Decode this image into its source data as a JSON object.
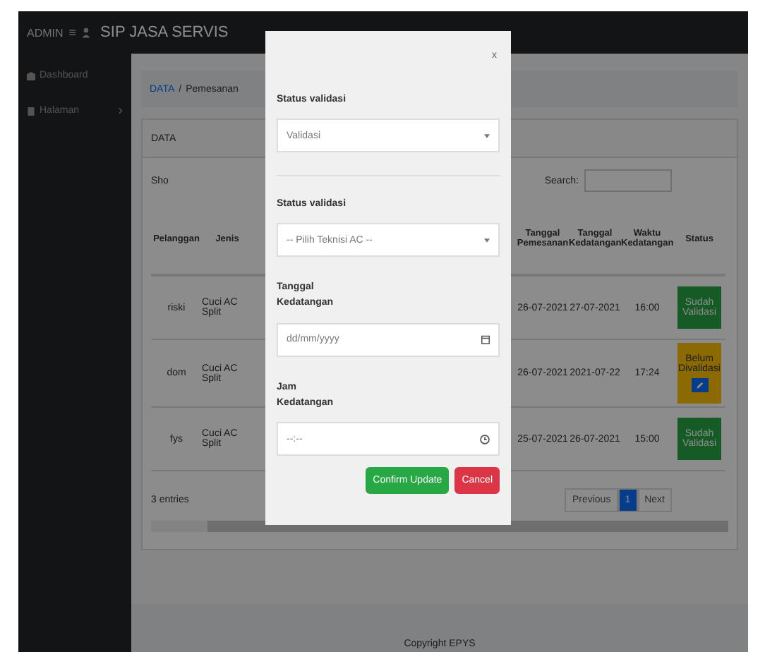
{
  "navbar": {
    "user": "ADMIN",
    "menu_glyph": "≡",
    "brand": "SIP JASA SERVIS"
  },
  "sidebar": {
    "items": [
      {
        "label": "Dashboard",
        "selected": false,
        "expandable": false
      },
      {
        "label": "Halaman",
        "selected": false,
        "expandable": true
      }
    ]
  },
  "breadcrumb": [
    "DATA",
    "/",
    "Pemesanan"
  ],
  "card": {
    "title": "DATA",
    "show_label": "Sho",
    "search_label": "Search:"
  },
  "table": {
    "columns": [
      "Pelanggan",
      "Jenis",
      "Tanggal Pemesanan",
      "Tanggal Kedatangan",
      "Waktu Kedatangan",
      "Status"
    ],
    "rows": [
      {
        "cells": [
          "riski",
          "Cuci AC Split",
          "26-07-2021",
          "27-07-2021",
          "16:00"
        ],
        "status": "Sudah Validasi",
        "validated": true
      },
      {
        "cells": [
          "dom",
          "Cuci AC Split",
          "26-07-2021",
          "2021-07-22",
          "17:24"
        ],
        "status": "Belum Divalidasi",
        "validated": false
      },
      {
        "cells": [
          "fys",
          "Cuci AC Split",
          "25-07-2021",
          "26-07-2021",
          "15:00"
        ],
        "status": "Sudah Validasi",
        "validated": true
      }
    ]
  },
  "info": "3 entries",
  "pagination": [
    {
      "label": "Previous",
      "selected": false
    },
    {
      "label": "1",
      "selected": true
    },
    {
      "label": "Next",
      "selected": false
    }
  ],
  "footer": "Copyright EPYS",
  "modal": {
    "close": "x",
    "fields": [
      {
        "kind": "select",
        "label": "Status validasi",
        "value": "Validasi"
      },
      {
        "kind": "select",
        "label": "Status validasi",
        "value": "-- Pilih Teknisi AC --"
      },
      {
        "kind": "date",
        "label": "Tanggal Kedatangan",
        "value": "dd/mm/yyyy"
      },
      {
        "kind": "time",
        "label": "Jam Kedatangan",
        "value": "--:--"
      }
    ],
    "buttons": [
      {
        "label": "Confirm Update",
        "kind": "primary"
      },
      {
        "label": "Cancel",
        "kind": "danger"
      }
    ]
  }
}
